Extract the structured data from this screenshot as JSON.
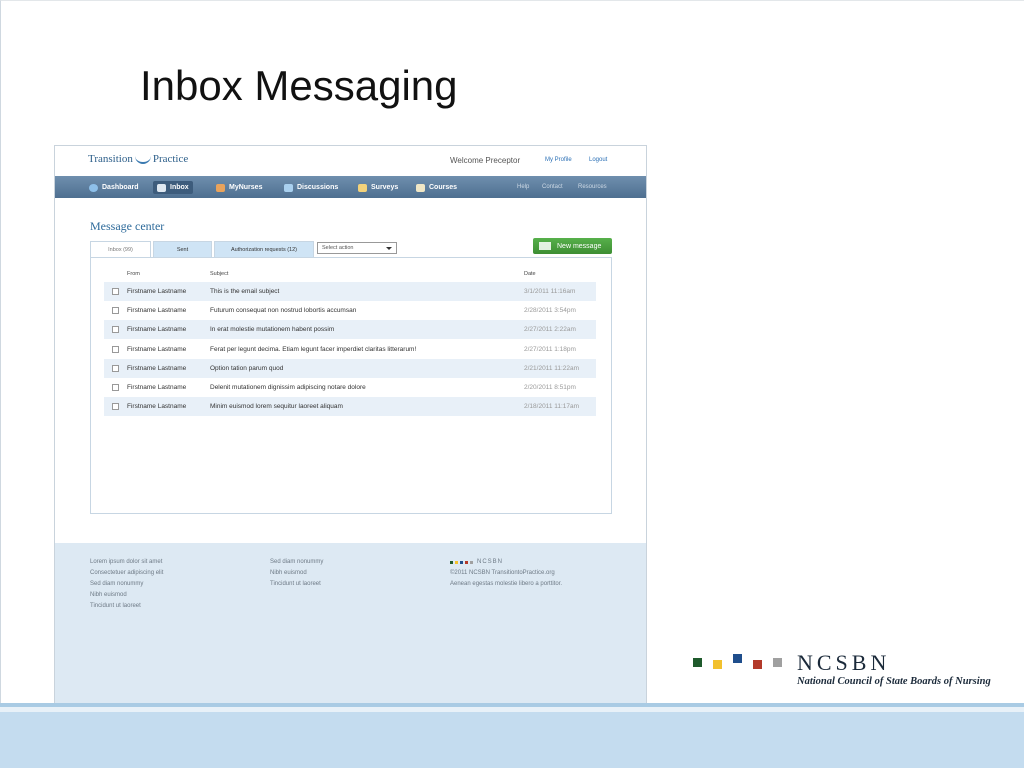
{
  "slide": {
    "title": "Inbox Messaging",
    "logo": {
      "brand": "NCSBN",
      "tagline": "National Council of State Boards of Nursing",
      "square_colors": [
        "#1f5a2c",
        "#f2c12e",
        "#1f4e8c",
        "#b33a2a",
        "#a0a0a0"
      ]
    }
  },
  "app": {
    "logo_left": "Transition",
    "logo_right": "Practice",
    "welcome": "Welcome Preceptor",
    "my_profile": "My Profile",
    "logout": "Logout",
    "nav": [
      {
        "label": "Dashboard",
        "icon": "globe-icon",
        "color": "#8ec0ea"
      },
      {
        "label": "Inbox",
        "icon": "envelope-icon",
        "color": "#dfe8f1",
        "active": true
      },
      {
        "label": "MyNurses",
        "icon": "person-icon",
        "color": "#e9a35c"
      },
      {
        "label": "Discussions",
        "icon": "chat-icon",
        "color": "#a9d0ef"
      },
      {
        "label": "Surveys",
        "icon": "clipboard-icon",
        "color": "#f3d27a"
      },
      {
        "label": "Courses",
        "icon": "pencil-icon",
        "color": "#f0e7c6"
      }
    ],
    "nav_right": [
      "Help",
      "Contact",
      "Resources"
    ],
    "message_center": "Message center",
    "tabs": [
      "Inbox (99)",
      "Sent",
      "Authorization requests (12)"
    ],
    "select_action": "Select action",
    "new_message": "New message",
    "columns": [
      "From",
      "Subject",
      "Date"
    ],
    "messages": [
      {
        "from": "Firstname Lastname",
        "subject": "This is the email subject",
        "date": "3/1/2011 11:16am"
      },
      {
        "from": "Firstname Lastname",
        "subject": "Futurum consequat non nostrud lobortis accumsan",
        "date": "2/28/2011 3:54pm"
      },
      {
        "from": "Firstname Lastname",
        "subject": "In erat molestie mutationem habent possim",
        "date": "2/27/2011 2:22am"
      },
      {
        "from": "Firstname Lastname",
        "subject": "Ferat per legunt decima. Etiam legunt facer imperdiet claritas litterarum!",
        "date": "2/27/2011 1:18pm"
      },
      {
        "from": "Firstname Lastname",
        "subject": "Option tation parum quod",
        "date": "2/21/2011 11:22am"
      },
      {
        "from": "Firstname Lastname",
        "subject": "Delenit mutationem dignissim adipiscing notare dolore",
        "date": "2/20/2011 8:51pm"
      },
      {
        "from": "Firstname Lastname",
        "subject": "Minim euismod lorem sequitur laoreet aliquam",
        "date": "2/18/2011 11:17am"
      }
    ],
    "footer": {
      "col1": [
        "Lorem ipsum dolor sit amet",
        "Consectetuer adipiscing elit",
        "Sed diam nonummy",
        "Nibh euismod",
        "Tincidunt ut laoreet"
      ],
      "col2": [
        "Sed diam nonummy",
        "Nibh euismod",
        "Tincidunt ut laoreet"
      ],
      "col3_brand": "NCSBN",
      "col3": [
        "©2011 NCSBN TransitiontoPractice.org",
        "Aenean egestas molestie libero a porttitor."
      ]
    }
  }
}
